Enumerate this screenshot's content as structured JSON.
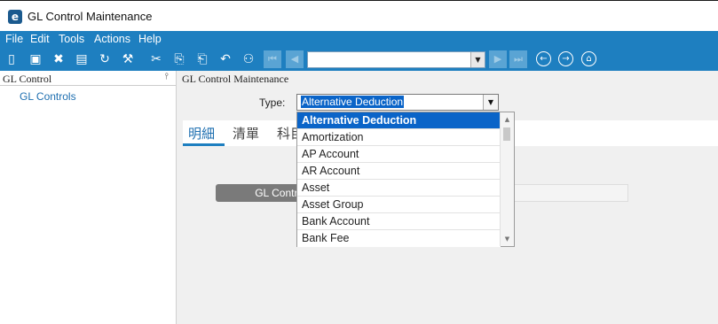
{
  "window": {
    "title": "GL Control Maintenance",
    "logo_letter": "e"
  },
  "menu": [
    "File",
    "Edit",
    "Tools",
    "Actions",
    "Help"
  ],
  "toolbar": {
    "record_selector_value": ""
  },
  "left_panel": {
    "header": "GL Control",
    "tree_item": "GL Controls"
  },
  "main": {
    "header": "GL Control Maintenance",
    "type_label": "Type:",
    "type_value": "Alternative Deduction",
    "tabs": [
      "明細",
      "清單",
      "科目"
    ],
    "active_tab_index": 0,
    "section_button": "GL Control..."
  },
  "dropdown": {
    "selected": "Alternative Deduction",
    "options": [
      "Alternative Deduction",
      "Amortization",
      "AP Account",
      "AR Account",
      "Asset",
      "Asset Group",
      "Bank Account",
      "Bank Fee"
    ]
  },
  "colors": {
    "menu_bar": "#1e7fc0",
    "selection": "#0a64c8",
    "link": "#1e6fb0",
    "section_button": "#7a7a7a"
  }
}
